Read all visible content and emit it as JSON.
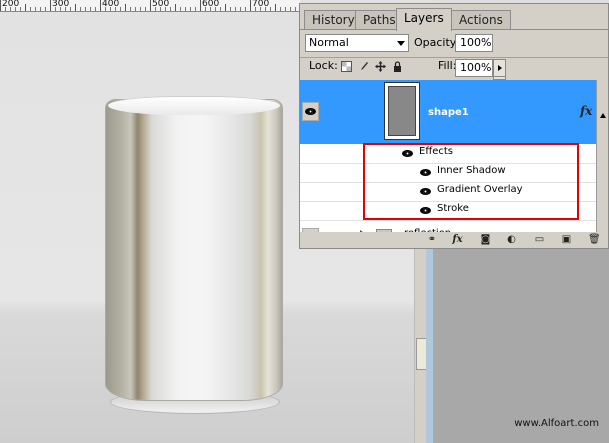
{
  "ruler": {
    "labels": [
      "200",
      "300",
      "400",
      "500",
      "600",
      "700"
    ]
  },
  "panel": {
    "tabs": [
      "History",
      "Paths",
      "Layers",
      "Actions"
    ],
    "active_tab": "Layers",
    "blend_mode": "Normal",
    "opacity_label": "Opacity:",
    "opacity_value": "100%",
    "lock_label": "Lock:",
    "fill_label": "Fill:",
    "fill_value": "100%",
    "layer": {
      "name": "shape1",
      "fx_label": "fx",
      "effects_label": "Effects",
      "effects": [
        "Inner Shadow",
        "Gradient Overlay",
        "Stroke"
      ]
    },
    "next_layer": "reflection"
  },
  "watermark": "www.Alfoart.com",
  "colors": {
    "selection": "#3399ff",
    "highlight_box": "#e60000"
  }
}
